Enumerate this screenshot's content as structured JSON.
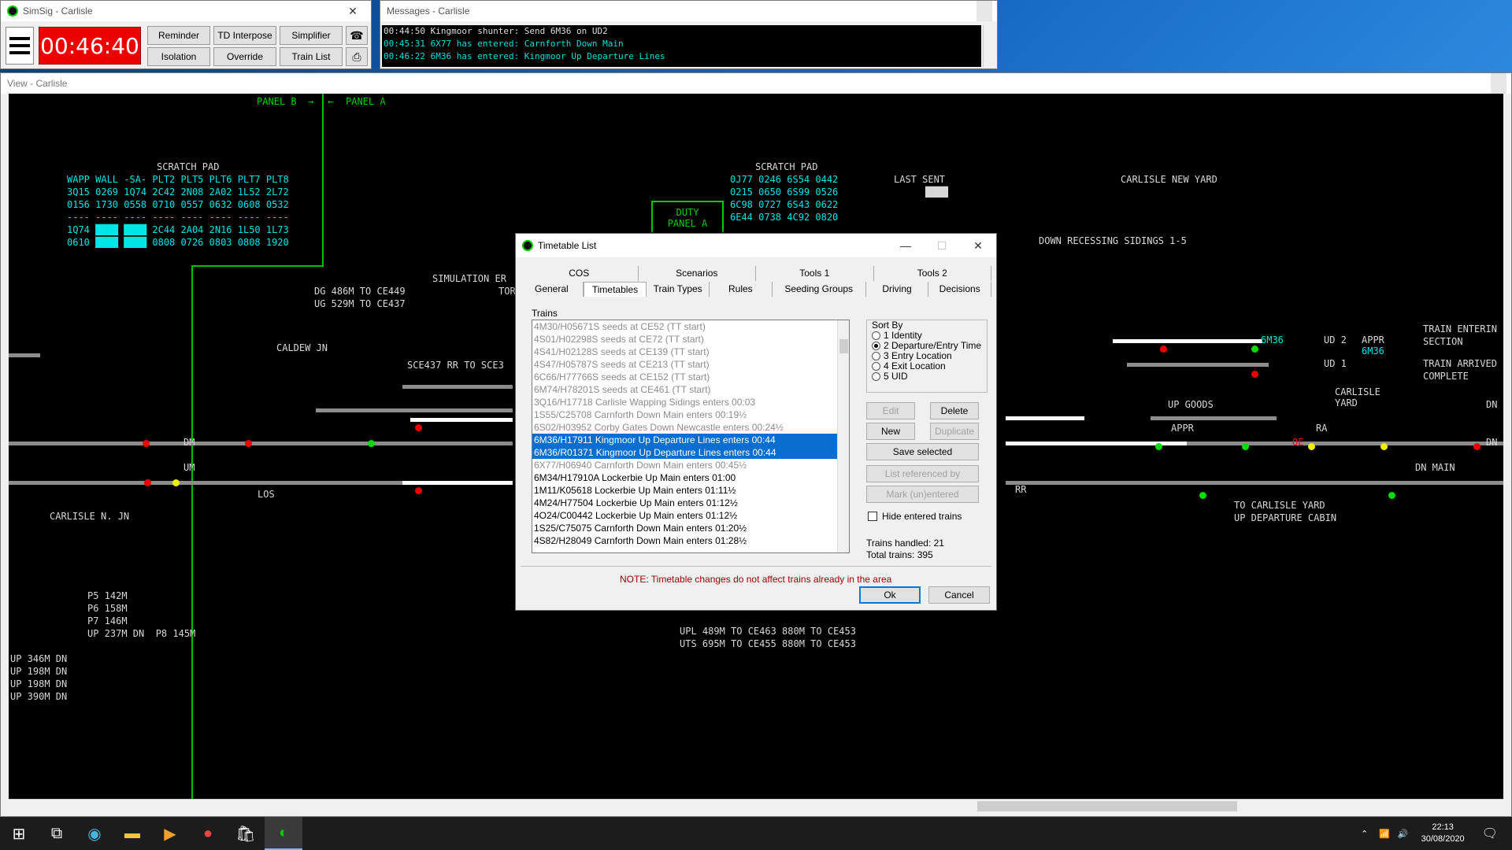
{
  "simsig": {
    "title": "SimSig - Carlisle",
    "clock": "00:46:40",
    "buttons": [
      "Reminder",
      "TD Interpose",
      "Simplifier",
      "Isolation",
      "Override",
      "Train List"
    ]
  },
  "messages": {
    "title": "Messages - Carlisle",
    "lines": [
      "00:44:50 Kingmoor shunter: Send 6M36 on UD2",
      "00:45:31 6X77 has entered: Carnforth Down Main",
      "00:46:22 6M36 has entered: Kingmoor Up Departure Lines"
    ]
  },
  "view": {
    "title": "View - Carlisle",
    "panel_b": "PANEL B",
    "panel_a": "PANEL A",
    "scratch_left": {
      "title": "SCRATCH PAD",
      "rows": [
        "WAPP WALL -SA- PLT2 PLT5 PLT6 PLT7 PLT8",
        "3Q15 0269 1Q74 2C42 2N08 2A02 1L52 2L72",
        "0156 1730 0558 0710 0557 0632 0608 0532",
        "---- ---- ---- ---- ---- ---- ---- ----",
        "1Q74 ████ ████ 2C44 2A04 2N16 1L50 1L73",
        "0610 ████ ████ 0808 0726 0803 0808 1920"
      ]
    },
    "scratch_right": {
      "title": "SCRATCH PAD",
      "rows": [
        "0J77 0246 6S54 0442",
        "0215 0650 6S99 0526",
        "6C98 0727 6S43 0622",
        "6E44 0738 4C92 0820"
      ]
    },
    "duty": "DUTY\nPANEL A",
    "last_sent": "LAST SENT",
    "labels": {
      "carlisle_new_yard": "CARLISLE NEW YARD",
      "down_recessing": "DOWN RECESSING SIDINGS 1-5",
      "dg": "DG 486M TO CE449",
      "ug": "UG 529M TO CE437",
      "sim_err": "SIMULATION ER",
      "tor": "TOR",
      "caldew": "CALDEW JN",
      "sce437": "SCE437 RR TO SCE3",
      "dm": "DM",
      "um": "UM",
      "los": "LOS",
      "carlisle_n_jn": "CARLISLE N. JN",
      "ud2": "UD 2",
      "ud1": "UD 1",
      "appr1": "APPR",
      "appr2": "APPR",
      "up_goods": "UP GOODS",
      "ra": "RA",
      "oe": "OE",
      "rr": "RR",
      "train_entering": "TRAIN ENTERIN",
      "section": "SECTION",
      "train_arrived": "TRAIN ARRIVED",
      "complete": "COMPLETE",
      "carlisle_yard": "CARLISLE\nYARD",
      "dn1": "DN",
      "dn2": "DN",
      "dn_main": "DN MAIN",
      "to_carlisle_yard": "TO CARLISLE YARD",
      "up_dep_cabin": "UP DEPARTURE CABIN",
      "berth_6m36": "6M36",
      "berth_6m36b": "6M36",
      "lengths_a": "P5 142M\nP6 158M\nP7 146M\nUP 237M DN  P8 145M",
      "lengths_b": "UP 346M DN\nUP 198M DN\nUP 198M DN\nUP 390M DN",
      "upl": "UPL 489M TO CE463 880M TO CE453",
      "uts": "UTS 695M TO CE455 880M TO CE453"
    }
  },
  "timetable": {
    "title": "Timetable List",
    "tabs_top": [
      "COS",
      "Scenarios",
      "Tools 1",
      "Tools 2"
    ],
    "tabs_bottom": [
      "General",
      "Timetables",
      "Train Types",
      "Rules",
      "Seeding Groups",
      "Driving",
      "Decisions"
    ],
    "active_tab": "Timetables",
    "trains_label": "Trains",
    "trains": [
      {
        "text": "4M30/H05671S seeds at CE52 (TT start)",
        "state": "dim"
      },
      {
        "text": "4S01/H02298S seeds at CE72 (TT start)",
        "state": "dim"
      },
      {
        "text": "4S41/H02128S seeds at CE139 (TT start)",
        "state": "dim"
      },
      {
        "text": "4S47/H05787S seeds at CE213 (TT start)",
        "state": "dim"
      },
      {
        "text": "6C66/H77766S seeds at CE152 (TT start)",
        "state": "dim"
      },
      {
        "text": "6M74/H78201S seeds at CE461 (TT start)",
        "state": "dim"
      },
      {
        "text": "3Q16/H17718 Carlisle Wapping Sidings enters 00:03",
        "state": "dim"
      },
      {
        "text": "1S55/C25708 Carnforth Down Main enters 00:19½",
        "state": "dim"
      },
      {
        "text": "6S02/H03952 Corby Gates Down Newcastle enters 00:24½",
        "state": "dim"
      },
      {
        "text": "6M36/H17911 Kingmoor Up Departure Lines enters 00:44",
        "state": "sel"
      },
      {
        "text": "6M36/R01371 Kingmoor Up Departure Lines enters 00:44",
        "state": "sel"
      },
      {
        "text": "6X77/H06940 Carnforth Down Main enters 00:45½",
        "state": "dim"
      },
      {
        "text": "6M34/H17910A Lockerbie Up Main enters 01:00",
        "state": "normal"
      },
      {
        "text": "1M11/K05618 Lockerbie Up Main enters 01:11½",
        "state": "normal"
      },
      {
        "text": "4M24/H77504 Lockerbie Up Main enters 01:12½",
        "state": "normal"
      },
      {
        "text": "4O24/C00442 Lockerbie Up Main enters 01:12½",
        "state": "normal"
      },
      {
        "text": "1S25/C75075 Carnforth Down Main enters 01:20½",
        "state": "normal"
      },
      {
        "text": "4S82/H28049 Carnforth Down Main enters 01:28½",
        "state": "normal"
      }
    ],
    "sort_by": "Sort By",
    "sort_options": [
      "1 Identity",
      "2 Departure/Entry Time",
      "3 Entry Location",
      "4 Exit Location",
      "5 UID"
    ],
    "sort_selected": 1,
    "btn_edit": "Edit",
    "btn_delete": "Delete",
    "btn_new": "New",
    "btn_duplicate": "Duplicate",
    "btn_save_selected": "Save selected",
    "btn_list_referenced": "List referenced by",
    "btn_mark": "Mark (un)entered",
    "hide_entered": "Hide entered trains",
    "trains_handled": "Trains handled: 21",
    "total_trains": "Total trains: 395",
    "note": "NOTE: Timetable changes do not affect trains already in the area",
    "btn_ok": "Ok",
    "btn_cancel": "Cancel"
  },
  "taskbar": {
    "time": "22:13",
    "date": "30/08/2020"
  }
}
